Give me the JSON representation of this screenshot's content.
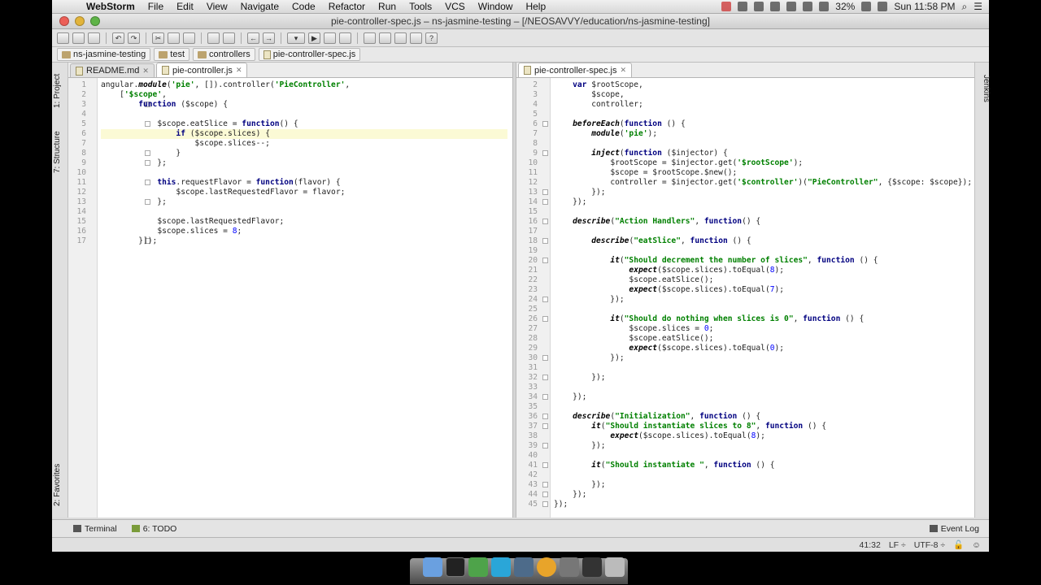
{
  "menubar": {
    "apple": "",
    "app": "WebStorm",
    "items": [
      "File",
      "Edit",
      "View",
      "Navigate",
      "Code",
      "Refactor",
      "Run",
      "Tools",
      "VCS",
      "Window",
      "Help"
    ],
    "battery": "32%",
    "clock": "Sun 11:58 PM"
  },
  "window": {
    "title": "pie-controller-spec.js – ns-jasmine-testing – [/NEOSAVVY/education/ns-jasmine-testing]"
  },
  "breadcrumb": [
    "ns-jasmine-testing",
    "test",
    "controllers",
    "pie-controller-spec.js"
  ],
  "left_tool_tabs": {
    "project": "1: Project",
    "structure": "7: Structure",
    "favorites": "2: Favorites"
  },
  "right_tool_tabs": {
    "jenkins": "Jenkins"
  },
  "left_editor": {
    "tabs": [
      "README.md",
      "pie-controller.js"
    ],
    "lines": [
      "angular.module('pie', []).controller('PieController',",
      "    ['$scope',",
      "        function ($scope) {",
      "",
      "            $scope.eatSlice = function() {",
      "                if ($scope.slices) {",
      "                    $scope.slices--;",
      "                }",
      "            };",
      "",
      "            this.requestFlavor = function(flavor) {",
      "                $scope.lastRequestedFlavor = flavor;",
      "            };",
      "",
      "            $scope.lastRequestedFlavor;",
      "            $scope.slices = 8;",
      "        }]);"
    ]
  },
  "right_editor": {
    "tabs": [
      "pie-controller-spec.js"
    ],
    "first_line": 2,
    "lines": [
      "    var $rootScope,",
      "        $scope,",
      "        controller;",
      "",
      "    beforeEach(function () {",
      "        module('pie');",
      "",
      "        inject(function ($injector) {",
      "            $rootScope = $injector.get('$rootScope');",
      "            $scope = $rootScope.$new();",
      "            controller = $injector.get('$controller')(\"PieController\", {$scope: $scope});",
      "        });",
      "    });",
      "",
      "    describe(\"Action Handlers\", function() {",
      "",
      "        describe(\"eatSlice\", function () {",
      "",
      "            it(\"Should decrement the number of slices\", function () {",
      "                expect($scope.slices).toEqual(8);",
      "                $scope.eatSlice();",
      "                expect($scope.slices).toEqual(7);",
      "            });",
      "",
      "            it(\"Should do nothing when slices is 0\", function () {",
      "                $scope.slices = 0;",
      "                $scope.eatSlice();",
      "                expect($scope.slices).toEqual(0);",
      "            });",
      "",
      "        });",
      "",
      "    });",
      "",
      "    describe(\"Initialization\", function () {",
      "        it(\"Should instantiate slices to 8\", function () {",
      "            expect($scope.slices).toEqual(8);",
      "        });",
      "",
      "        it(\"Should instantiate \", function () {",
      "",
      "        });",
      "    });",
      "});"
    ]
  },
  "bottom_tools": {
    "terminal": "Terminal",
    "todo": "6: TODO",
    "event_log": "Event Log"
  },
  "status": {
    "position": "41:32",
    "line_sep": "LF ÷",
    "encoding": "UTF-8 ÷"
  },
  "colors": {
    "accent": "#3c6eb4",
    "keyword": "#000080",
    "string": "#008000",
    "number": "#0000ff"
  }
}
